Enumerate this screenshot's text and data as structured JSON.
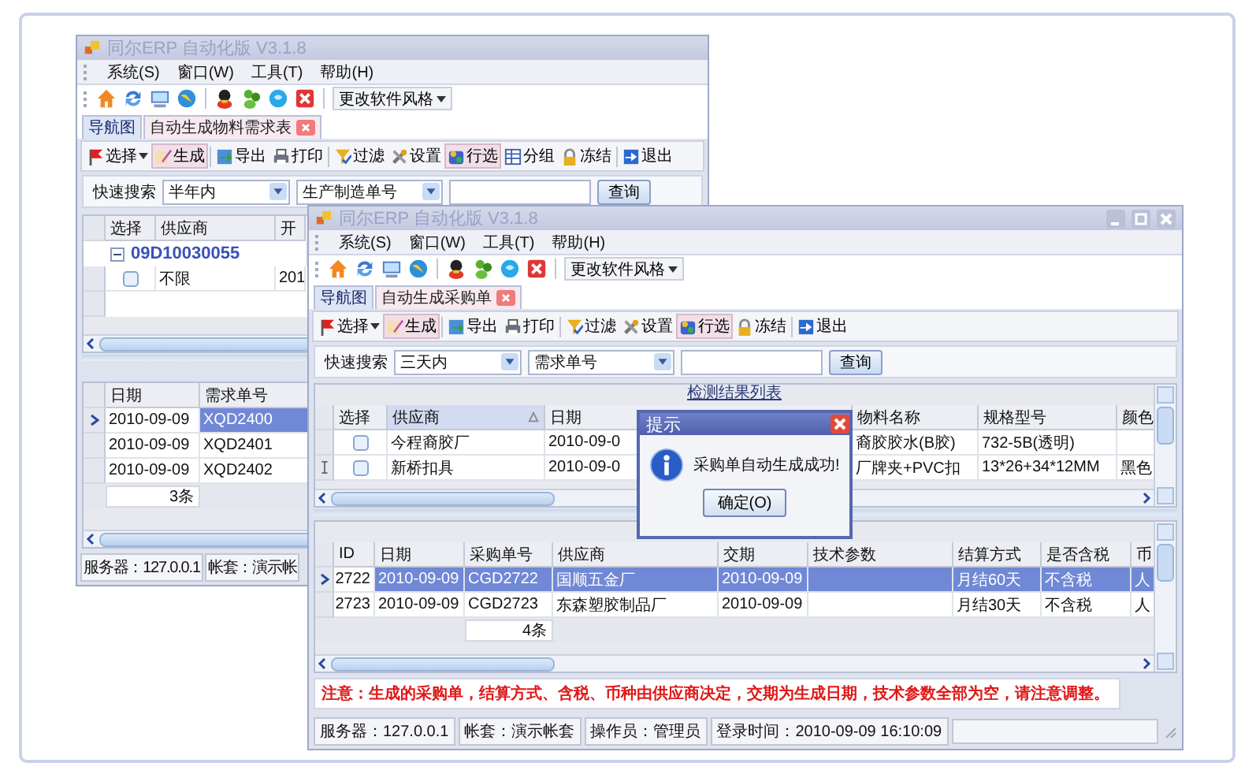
{
  "back_window": {
    "title": "同尔ERP 自动化版 V3.1.8",
    "menu": [
      "系统(S)",
      "窗口(W)",
      "工具(T)",
      "帮助(H)"
    ],
    "style_button": "更改软件风格",
    "tabs": [
      {
        "label": "导航图",
        "selected": false,
        "closable": false
      },
      {
        "label": "自动生成物料需求表",
        "selected": true,
        "closable": true
      }
    ],
    "toolbar": [
      {
        "kind": "select",
        "label": "选择",
        "dropdown": true,
        "pressed": false
      },
      {
        "kind": "generate",
        "label": "生成",
        "dropdown": false,
        "pressed": true
      },
      {
        "kind": "export",
        "label": "导出",
        "dropdown": false,
        "pressed": false
      },
      {
        "kind": "print",
        "label": "打印",
        "dropdown": false,
        "pressed": false
      },
      {
        "kind": "filter",
        "label": "过滤",
        "dropdown": false,
        "pressed": false
      },
      {
        "kind": "settings",
        "label": "设置",
        "dropdown": false,
        "pressed": false
      },
      {
        "kind": "rowselect",
        "label": "行选",
        "dropdown": false,
        "pressed": true
      },
      {
        "kind": "group",
        "label": "分组",
        "dropdown": false,
        "pressed": false
      },
      {
        "kind": "freeze",
        "label": "冻结",
        "dropdown": false,
        "pressed": false
      },
      {
        "kind": "exit",
        "label": "退出",
        "dropdown": false,
        "pressed": false
      }
    ],
    "search": {
      "label": "快速搜索",
      "range": "半年内",
      "field": "生产制造单号",
      "button": "查询"
    },
    "upper_grid": {
      "columns": [
        {
          "label": "选择",
          "sorted": false
        },
        {
          "label": "供应商",
          "sorted": false
        },
        {
          "label": "开",
          "sorted": false
        }
      ],
      "rows": [
        {
          "kind": "group",
          "expanded": true,
          "label": "09D10030055"
        },
        {
          "kind": "record",
          "current": false,
          "checked": false,
          "cells": [
            "",
            "不限",
            "201"
          ]
        }
      ]
    },
    "lower_grid": {
      "columns": [
        {
          "label": "日期",
          "sorted": false
        },
        {
          "label": "需求单号",
          "sorted": false
        }
      ],
      "rows": [
        {
          "kind": "record",
          "current": true,
          "selected": true,
          "cells": [
            "2010-09-09",
            "XQD2400"
          ]
        },
        {
          "kind": "record",
          "current": false,
          "selected": false,
          "cells": [
            "2010-09-09",
            "XQD2401"
          ]
        },
        {
          "kind": "record",
          "current": false,
          "selected": false,
          "cells": [
            "2010-09-09",
            "XQD2402"
          ]
        }
      ],
      "footer": "3条"
    },
    "status": [
      "服务器：127.0.0.1",
      "帐套：演示帐"
    ]
  },
  "front_window": {
    "title": "同尔ERP 自动化版 V3.1.8",
    "menu": [
      "系统(S)",
      "窗口(W)",
      "工具(T)",
      "帮助(H)"
    ],
    "style_button": "更改软件风格",
    "tabs": [
      {
        "label": "导航图",
        "selected": false,
        "closable": false
      },
      {
        "label": "自动生成采购单",
        "selected": true,
        "closable": true
      }
    ],
    "toolbar": [
      {
        "kind": "select",
        "label": "选择",
        "dropdown": true,
        "pressed": false
      },
      {
        "kind": "generate",
        "label": "生成",
        "dropdown": false,
        "pressed": true
      },
      {
        "kind": "export",
        "label": "导出",
        "dropdown": false,
        "pressed": false
      },
      {
        "kind": "print",
        "label": "打印",
        "dropdown": false,
        "pressed": false
      },
      {
        "kind": "filter",
        "label": "过滤",
        "dropdown": false,
        "pressed": false
      },
      {
        "kind": "settings",
        "label": "设置",
        "dropdown": false,
        "pressed": false
      },
      {
        "kind": "rowselect",
        "label": "行选",
        "dropdown": false,
        "pressed": true
      },
      {
        "kind": "freeze",
        "label": "冻结",
        "dropdown": false,
        "pressed": false
      },
      {
        "kind": "exit",
        "label": "退出",
        "dropdown": false,
        "pressed": false
      }
    ],
    "search": {
      "label": "快速搜索",
      "range": "三天内",
      "field": "需求单号",
      "button": "查询"
    },
    "upper_grid": {
      "title": "检测结果列表",
      "columns": [
        {
          "label": "选择",
          "sorted": false
        },
        {
          "label": "供应商",
          "sorted": true
        },
        {
          "label": "日期",
          "sorted": false
        },
        {
          "label": "物料名称",
          "sorted": false
        },
        {
          "label": "规格型号",
          "sorted": false
        },
        {
          "label": "颜色",
          "sorted": false
        }
      ],
      "rows": [
        {
          "kind": "record",
          "current": false,
          "editing": false,
          "checked": false,
          "cells": [
            "",
            "今程裔胶厂",
            "2010-09-0",
            "裔胶胶水(B胶)",
            "732-5B(透明)",
            ""
          ]
        },
        {
          "kind": "record",
          "current": false,
          "editing": true,
          "checked": false,
          "cells": [
            "",
            "新桥扣具",
            "2010-09-0",
            "厂牌夹+PVC扣",
            "13*26+34*12MM",
            "黑色"
          ]
        }
      ]
    },
    "lower_grid": {
      "columns": [
        {
          "label": "ID",
          "sorted": false
        },
        {
          "label": "日期",
          "sorted": false
        },
        {
          "label": "采购单号",
          "sorted": false
        },
        {
          "label": "供应商",
          "sorted": false
        },
        {
          "label": "交期",
          "sorted": false
        },
        {
          "label": "技术参数",
          "sorted": false
        },
        {
          "label": "结算方式",
          "sorted": false
        },
        {
          "label": "是否含税",
          "sorted": false
        },
        {
          "label": "币",
          "sorted": false
        }
      ],
      "rows": [
        {
          "kind": "record",
          "current": true,
          "selected": true,
          "cells": [
            "2722",
            "2010-09-09",
            "CGD2722",
            "国顺五金厂",
            "2010-09-09",
            "",
            "月结60天",
            "不含税",
            "人"
          ]
        },
        {
          "kind": "record",
          "current": false,
          "selected": false,
          "cells": [
            "2723",
            "2010-09-09",
            "CGD2723",
            "东森塑胶制品厂",
            "2010-09-09",
            "",
            "月结30天",
            "不含税",
            "人"
          ]
        }
      ],
      "footer": "4条"
    },
    "notice": "注意：生成的采购单，结算方式、含税、币种由供应商决定，交期为生成日期，技术参数全部为空，请注意调整。",
    "status": [
      "服务器：127.0.0.1",
      "帐套：演示帐套",
      "操作员：管理员",
      "登录时间：2010-09-09 16:10:09"
    ]
  },
  "dialog": {
    "title": "提示",
    "message": "采购单自动生成成功!",
    "button": "确定(O)"
  }
}
